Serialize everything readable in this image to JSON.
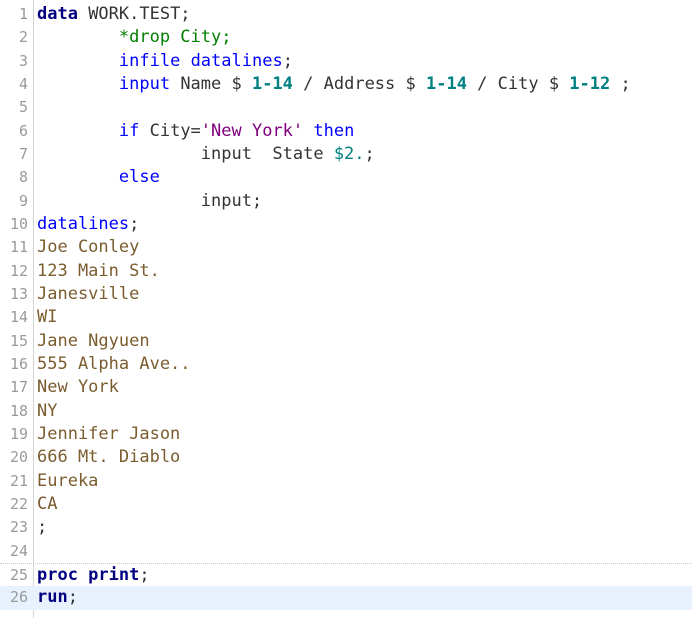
{
  "editor": {
    "lines": [
      {
        "n": "1",
        "tokens": [
          {
            "t": "data",
            "c": "kw-bold"
          },
          {
            "t": " WORK.TEST;",
            "c": "plain"
          }
        ]
      },
      {
        "n": "2",
        "tokens": [
          {
            "t": "        ",
            "c": "plain"
          },
          {
            "t": "*drop City;",
            "c": "comment"
          }
        ]
      },
      {
        "n": "3",
        "tokens": [
          {
            "t": "        ",
            "c": "plain"
          },
          {
            "t": "infile",
            "c": "kw"
          },
          {
            "t": " ",
            "c": "plain"
          },
          {
            "t": "datalines",
            "c": "kw"
          },
          {
            "t": ";",
            "c": "plain"
          }
        ]
      },
      {
        "n": "4",
        "tokens": [
          {
            "t": "        ",
            "c": "plain"
          },
          {
            "t": "input",
            "c": "kw"
          },
          {
            "t": " Name $ ",
            "c": "plain"
          },
          {
            "t": "1-14",
            "c": "num"
          },
          {
            "t": " / Address $ ",
            "c": "plain"
          },
          {
            "t": "1-14",
            "c": "num"
          },
          {
            "t": " / City $ ",
            "c": "plain"
          },
          {
            "t": "1-12",
            "c": "num"
          },
          {
            "t": " ;",
            "c": "plain"
          }
        ]
      },
      {
        "n": "5",
        "tokens": []
      },
      {
        "n": "6",
        "tokens": [
          {
            "t": "        ",
            "c": "plain"
          },
          {
            "t": "if",
            "c": "kw"
          },
          {
            "t": " City=",
            "c": "plain"
          },
          {
            "t": "'New York'",
            "c": "string"
          },
          {
            "t": " ",
            "c": "plain"
          },
          {
            "t": "then",
            "c": "kw"
          }
        ]
      },
      {
        "n": "7",
        "tokens": [
          {
            "t": "                input  State ",
            "c": "plain"
          },
          {
            "t": "$2.",
            "c": "fmt"
          },
          {
            "t": ";",
            "c": "plain"
          }
        ]
      },
      {
        "n": "8",
        "tokens": [
          {
            "t": "        ",
            "c": "plain"
          },
          {
            "t": "else",
            "c": "kw"
          }
        ]
      },
      {
        "n": "9",
        "tokens": [
          {
            "t": "                input;",
            "c": "plain"
          }
        ]
      },
      {
        "n": "10",
        "tokens": [
          {
            "t": "datalines",
            "c": "kw"
          },
          {
            "t": ";",
            "c": "plain"
          }
        ]
      },
      {
        "n": "11",
        "tokens": [
          {
            "t": "Joe Conley",
            "c": "data"
          }
        ]
      },
      {
        "n": "12",
        "tokens": [
          {
            "t": "123 Main St.",
            "c": "data"
          }
        ]
      },
      {
        "n": "13",
        "tokens": [
          {
            "t": "Janesville",
            "c": "data"
          }
        ]
      },
      {
        "n": "14",
        "tokens": [
          {
            "t": "WI",
            "c": "data"
          }
        ]
      },
      {
        "n": "15",
        "tokens": [
          {
            "t": "Jane Ngyuen",
            "c": "data"
          }
        ]
      },
      {
        "n": "16",
        "tokens": [
          {
            "t": "555 Alpha Ave..",
            "c": "data"
          }
        ]
      },
      {
        "n": "17",
        "tokens": [
          {
            "t": "New York",
            "c": "data"
          }
        ]
      },
      {
        "n": "18",
        "tokens": [
          {
            "t": "NY",
            "c": "data"
          }
        ]
      },
      {
        "n": "19",
        "tokens": [
          {
            "t": "Jennifer Jason",
            "c": "data"
          }
        ]
      },
      {
        "n": "20",
        "tokens": [
          {
            "t": "666 Mt. Diablo",
            "c": "data"
          }
        ]
      },
      {
        "n": "21",
        "tokens": [
          {
            "t": "Eureka",
            "c": "data"
          }
        ]
      },
      {
        "n": "22",
        "tokens": [
          {
            "t": "CA",
            "c": "data"
          }
        ]
      },
      {
        "n": "23",
        "tokens": [
          {
            "t": ";",
            "c": "plain"
          }
        ]
      },
      {
        "n": "24",
        "tokens": []
      },
      {
        "n": "25",
        "tokens": [
          {
            "t": "proc print",
            "c": "kw-bold"
          },
          {
            "t": ";",
            "c": "plain"
          }
        ]
      },
      {
        "n": "26",
        "tokens": [
          {
            "t": "run",
            "c": "kw-bold"
          },
          {
            "t": ";",
            "c": "plain"
          }
        ]
      }
    ],
    "current_line": 26,
    "separator_lines": [
      1,
      25
    ]
  },
  "colors": {
    "keyword_bold": "#000080",
    "keyword": "#0000ff",
    "comment": "#008000",
    "string": "#800080",
    "number": "#008080",
    "datalines": "#7a5c2e",
    "line_number": "#9a9a9a",
    "current_line_bg": "#e8f2fe"
  }
}
